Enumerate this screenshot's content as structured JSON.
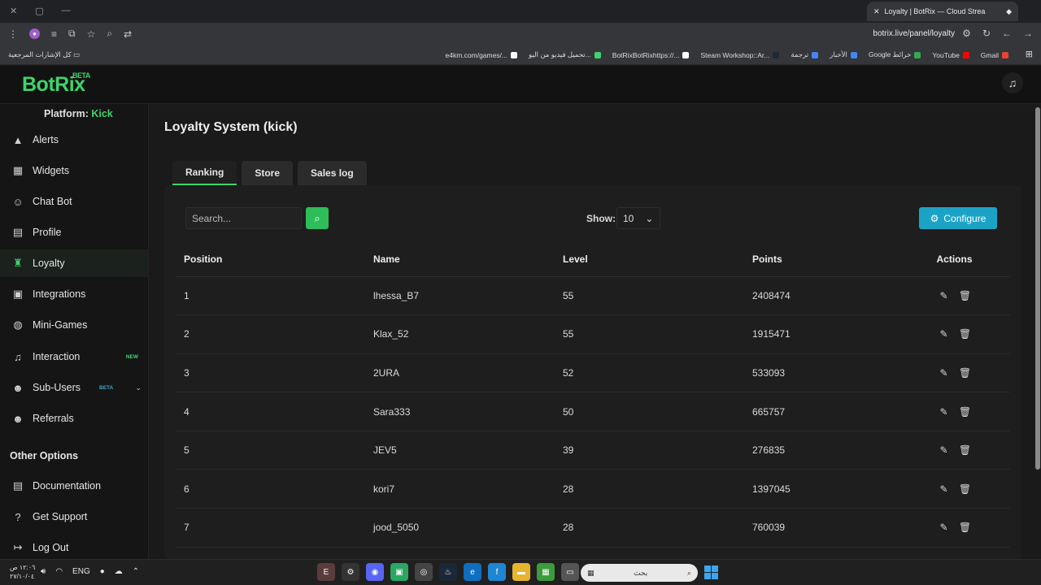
{
  "browser": {
    "tab_title": "Loyalty | BotRix — Cloud Strea",
    "url": "botrix.live/panel/loyalty",
    "all_bookmarks": "كل الإشارات المرجعية",
    "bookmarks": [
      {
        "label": "Gmail",
        "color": "#ea4335"
      },
      {
        "label": "YouTube",
        "color": "#ff0000"
      },
      {
        "label": "Google خرائط",
        "color": "#34a853"
      },
      {
        "label": "الأخبار",
        "color": "#4285f4"
      },
      {
        "label": "ترجمة",
        "color": "#4285f4"
      },
      {
        "label": "Steam Workshop::Ar...",
        "color": "#1b2838"
      },
      {
        "label": "BotRixBotRixhttps://...",
        "color": "#ffffff"
      },
      {
        "label": "تحميل فيديو من اليو...",
        "color": "#3fd36b"
      },
      {
        "label": "e4km.com/games/...",
        "color": "#ffffff"
      }
    ]
  },
  "app": {
    "logo": "BotRix",
    "logo_badge": "BETA",
    "platform_label": "Platform:",
    "platform_value": "Kick"
  },
  "sidebar": {
    "items": [
      {
        "label": "Alerts",
        "icon": "warning-icon"
      },
      {
        "label": "Widgets",
        "icon": "grid-icon"
      },
      {
        "label": "Chat Bot",
        "icon": "robot-icon"
      },
      {
        "label": "Profile",
        "icon": "id-card-icon"
      },
      {
        "label": "Loyalty",
        "icon": "trophy-icon",
        "active": true
      },
      {
        "label": "Integrations",
        "icon": "plug-icon"
      },
      {
        "label": "Mini-Games",
        "icon": "gamepad-icon"
      },
      {
        "label": "Interaction",
        "icon": "music-icon",
        "badge": "NEW"
      },
      {
        "label": "Sub-Users",
        "icon": "users-icon",
        "badge": "BETA"
      },
      {
        "label": "Referrals",
        "icon": "user-group-icon"
      }
    ],
    "other_title": "Other Options",
    "other_items": [
      {
        "label": "Documentation",
        "icon": "book-icon"
      },
      {
        "label": "Get Support",
        "icon": "question-icon"
      },
      {
        "label": "Log Out",
        "icon": "logout-icon"
      }
    ]
  },
  "main": {
    "title": "Loyalty System (kick)",
    "tabs": [
      "Ranking",
      "Store",
      "Sales log"
    ],
    "search_placeholder": "Search...",
    "show_label": "Show:",
    "show_value": "10",
    "configure_label": "Configure",
    "columns": [
      "Position",
      "Name",
      "Level",
      "Points",
      "Actions"
    ],
    "rows": [
      {
        "position": "1",
        "name": "lhessa_B7",
        "level": "55",
        "points": "2408474"
      },
      {
        "position": "2",
        "name": "Klax_52",
        "level": "55",
        "points": "1915471"
      },
      {
        "position": "3",
        "name": "2URA",
        "level": "52",
        "points": "533093"
      },
      {
        "position": "4",
        "name": "Sara333",
        "level": "50",
        "points": "665757"
      },
      {
        "position": "5",
        "name": "JEV5",
        "level": "39",
        "points": "276835"
      },
      {
        "position": "6",
        "name": "kori7",
        "level": "28",
        "points": "1397045"
      },
      {
        "position": "7",
        "name": "jood_5050",
        "level": "28",
        "points": "760039"
      }
    ]
  },
  "taskbar": {
    "time": "١٢:٠٦ ص",
    "date": "٢٧/١٠/٠٤",
    "lang": "ENG",
    "search_placeholder": "بحث"
  }
}
